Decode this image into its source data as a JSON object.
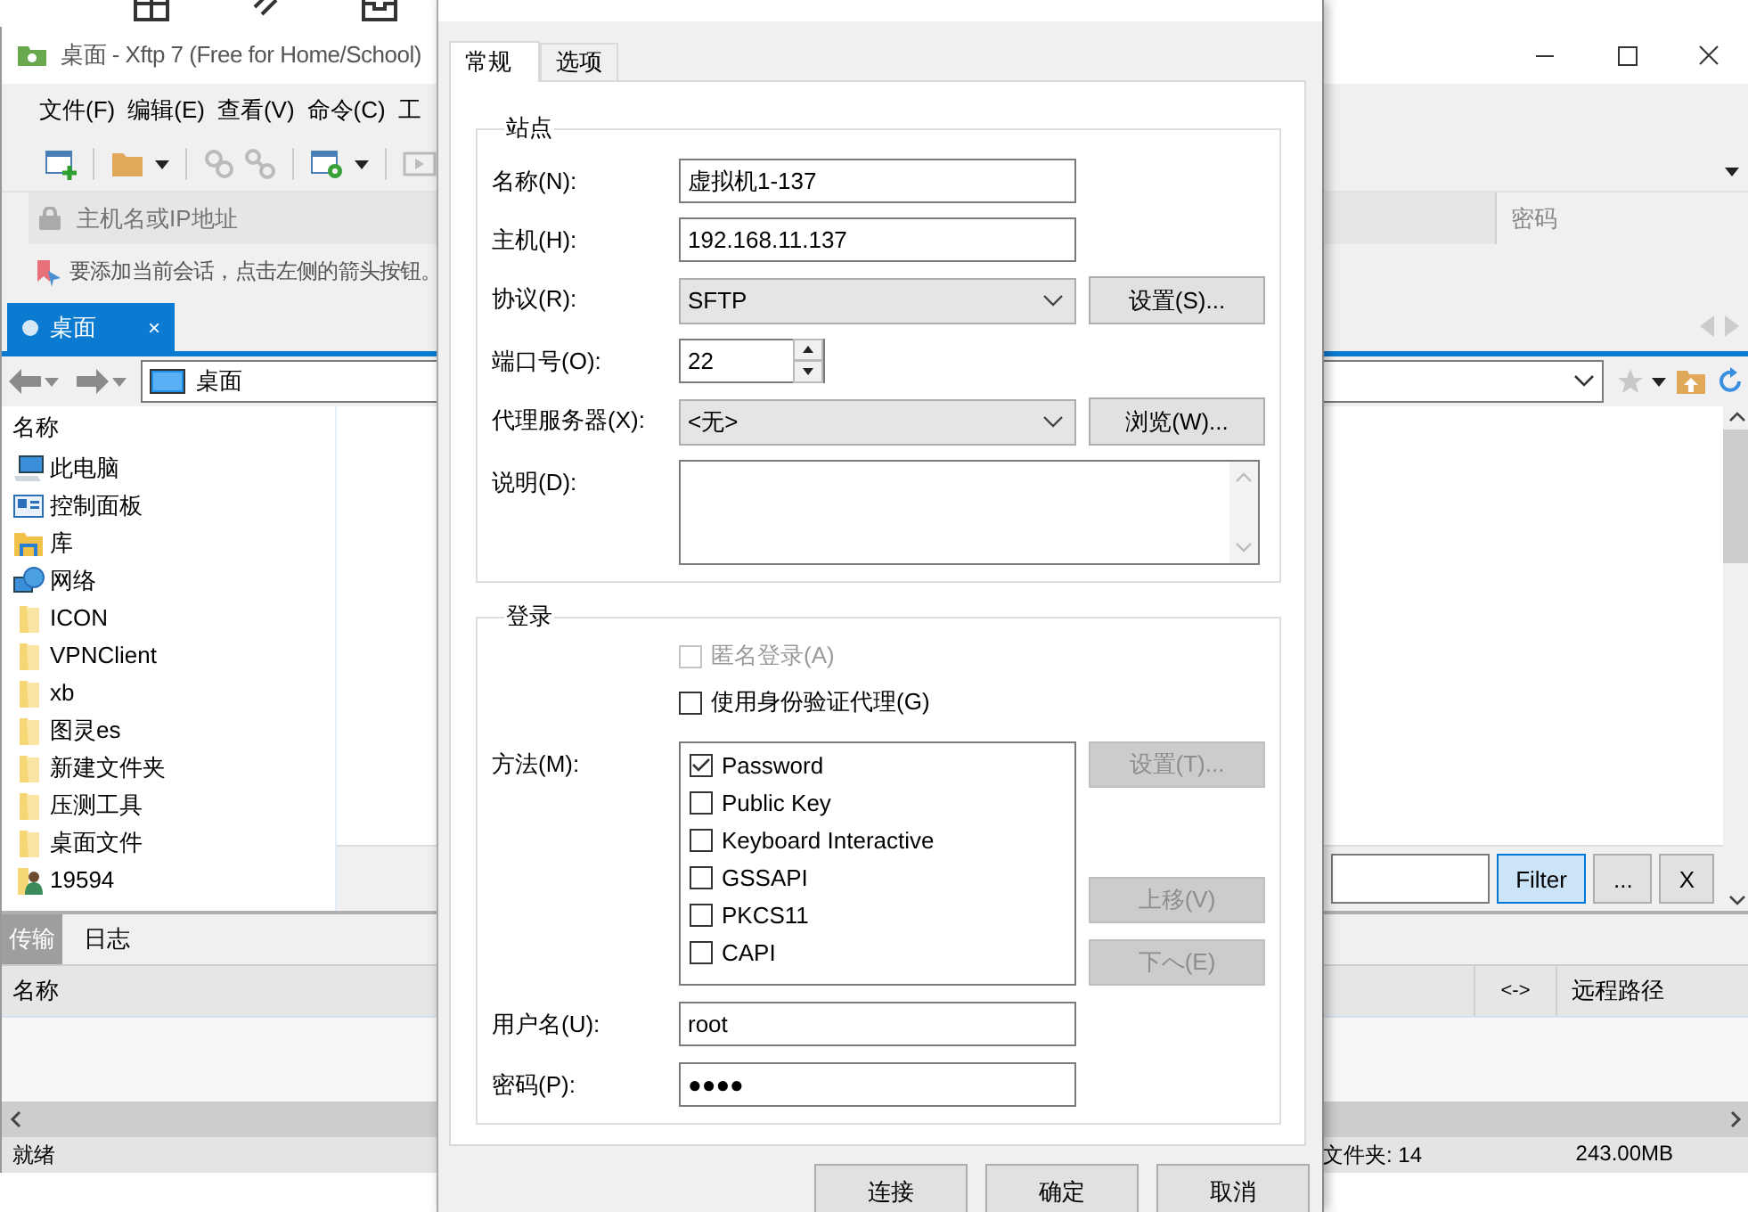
{
  "main_window": {
    "title": "桌面 - Xftp 7 (Free for Home/School)",
    "menu": [
      "文件(F)",
      "编辑(E)",
      "查看(V)",
      "命令(C)",
      "工"
    ],
    "address_placeholder": "主机名或IP地址",
    "password_column": "密码",
    "hint": "要添加当前会话，点击左侧的箭头按钮。",
    "tabs": [
      {
        "label": "桌面",
        "selected": true,
        "close": "×"
      }
    ],
    "path": "桌面",
    "file_list": {
      "column": "名称",
      "items": [
        {
          "name": "此电脑",
          "kind": "computer"
        },
        {
          "name": "控制面板",
          "kind": "control-panel"
        },
        {
          "name": "库",
          "kind": "library"
        },
        {
          "name": "网络",
          "kind": "network"
        },
        {
          "name": "ICON",
          "kind": "folder"
        },
        {
          "name": "VPNClient",
          "kind": "folder"
        },
        {
          "name": "xb",
          "kind": "folder"
        },
        {
          "name": "图灵es",
          "kind": "folder"
        },
        {
          "name": "新建文件夹",
          "kind": "folder"
        },
        {
          "name": "压测工具",
          "kind": "folder"
        },
        {
          "name": "桌面文件",
          "kind": "folder"
        },
        {
          "name": "19594",
          "kind": "user-folder"
        }
      ]
    },
    "filter_buttons": [
      {
        "label": "Filter",
        "default": true
      },
      {
        "label": "...",
        "default": false
      },
      {
        "label": "X",
        "default": false
      }
    ],
    "transfer_tabs": [
      {
        "label": "传输",
        "selected": true
      },
      {
        "label": "日志",
        "selected": false
      }
    ],
    "transfer_columns": [
      "名称",
      "<->",
      "远程路径"
    ],
    "status": {
      "text": "就绪",
      "folders": "文件夹: 14",
      "size": "243.00MB"
    }
  },
  "dialog": {
    "tabs": [
      {
        "label": "常规",
        "selected": true
      },
      {
        "label": "选项",
        "selected": false
      }
    ],
    "site": {
      "legend": "站点",
      "rows": [
        {
          "label": "名称(N):",
          "kind": "text",
          "value": "虚拟机1-137"
        },
        {
          "label": "主机(H):",
          "kind": "text",
          "value": "192.168.11.137"
        },
        {
          "label": "协议(R):",
          "kind": "select",
          "value": "SFTP",
          "button": {
            "label": "设置(S)...",
            "disabled": false
          }
        },
        {
          "label": "端口号(O):",
          "kind": "spin",
          "value": "22"
        },
        {
          "label": "代理服务器(X):",
          "kind": "select",
          "value": "<无>",
          "button": {
            "label": "浏览(W)...",
            "disabled": false
          }
        },
        {
          "label": "说明(D):",
          "kind": "textarea"
        }
      ]
    },
    "login": {
      "legend": "登录",
      "options": [
        {
          "label": "匿名登录(A)",
          "checked": false,
          "disabled": true
        },
        {
          "label": "使用身份验证代理(G)",
          "checked": false,
          "disabled": false
        }
      ],
      "method_label": "方法(M):",
      "methods": [
        {
          "label": "Password",
          "checked": true
        },
        {
          "label": "Public Key",
          "checked": false
        },
        {
          "label": "Keyboard Interactive",
          "checked": false
        },
        {
          "label": "GSSAPI",
          "checked": false
        },
        {
          "label": "PKCS11",
          "checked": false
        },
        {
          "label": "CAPI",
          "checked": false
        }
      ],
      "method_buttons": [
        {
          "label": "设置(T)...",
          "disabled": true
        },
        {
          "label": "上移(V)",
          "disabled": true
        },
        {
          "label": "下へ(E)",
          "disabled": true
        }
      ],
      "fields": [
        {
          "label": "用户名(U):",
          "value": "root"
        },
        {
          "label": "密码(P):",
          "value": "●●●●"
        }
      ]
    },
    "buttons": [
      "连接",
      "确定",
      "取消"
    ]
  }
}
